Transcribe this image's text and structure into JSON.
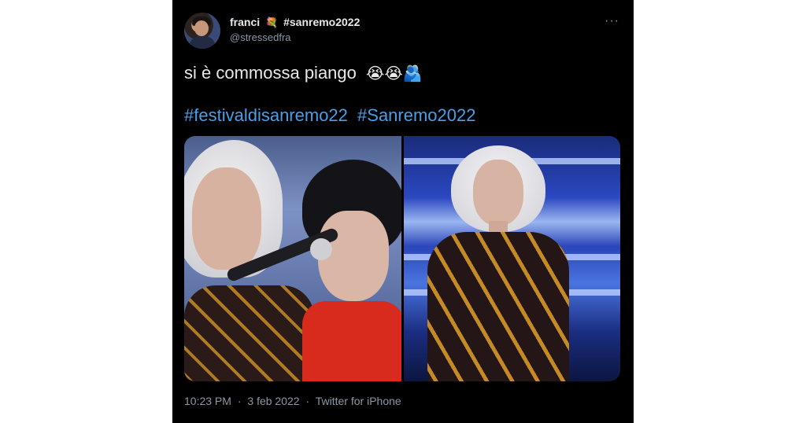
{
  "tweet": {
    "display_name": "franci",
    "name_emoji": "💐",
    "name_hashtag": "#sanremo2022",
    "handle": "@stressedfra",
    "more_glyph": "···",
    "text": "si è commossa piango",
    "text_emojis": "😭😭🫂",
    "hashtags": [
      "#festivaldisanremo22",
      "#Sanremo2022"
    ],
    "time": "10:23 PM",
    "separator": "·",
    "date": "3 feb 2022",
    "source": "Twitter for iPhone"
  },
  "colors": {
    "background": "#000000",
    "text": "#e7e9ea",
    "secondary_text": "#8b98a5",
    "link": "#4a9fe8"
  },
  "icons": {
    "more": "more-options-icon"
  }
}
